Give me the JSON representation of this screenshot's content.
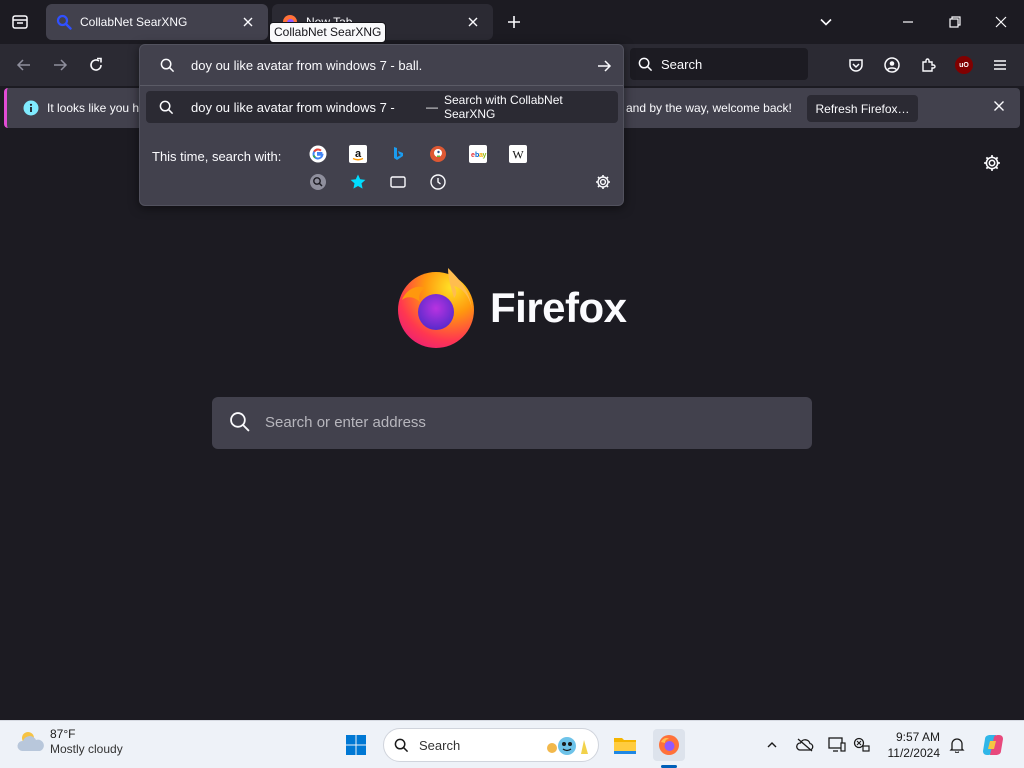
{
  "tabs": [
    {
      "title": "CollabNet SearXNG",
      "active": true
    },
    {
      "title": "New Tab",
      "active": false
    }
  ],
  "tooltip": "CollabNet SearXNG",
  "toolbar": {
    "search_placeholder": "Search"
  },
  "urlbar": {
    "input_value": "doy ou like avatar from windows 7 - ball.",
    "result_text": "doy ou like avatar from windows 7 -",
    "result_action_dash": "—",
    "result_action": "Search with CollabNet SearXNG",
    "oneoff_label": "This time, search with:",
    "engines": [
      "Google",
      "Amazon",
      "Bing",
      "DuckDuckGo",
      "eBay",
      "Wikipedia",
      "SearXNG",
      "Bookmarks",
      "Tabs",
      "History"
    ]
  },
  "notification": {
    "text_start": "It looks like you ha",
    "text_end": "and by the way, welcome back!",
    "button": "Refresh Firefox…"
  },
  "content": {
    "brand": "Firefox",
    "search_placeholder": "Search or enter address"
  },
  "taskbar": {
    "temperature": "87°F",
    "condition": "Mostly cloudy",
    "search_label": "Search",
    "time": "9:57 AM",
    "date": "11/2/2024"
  },
  "colors": {
    "accent": "#e24cd5",
    "ublock": "#800000"
  }
}
